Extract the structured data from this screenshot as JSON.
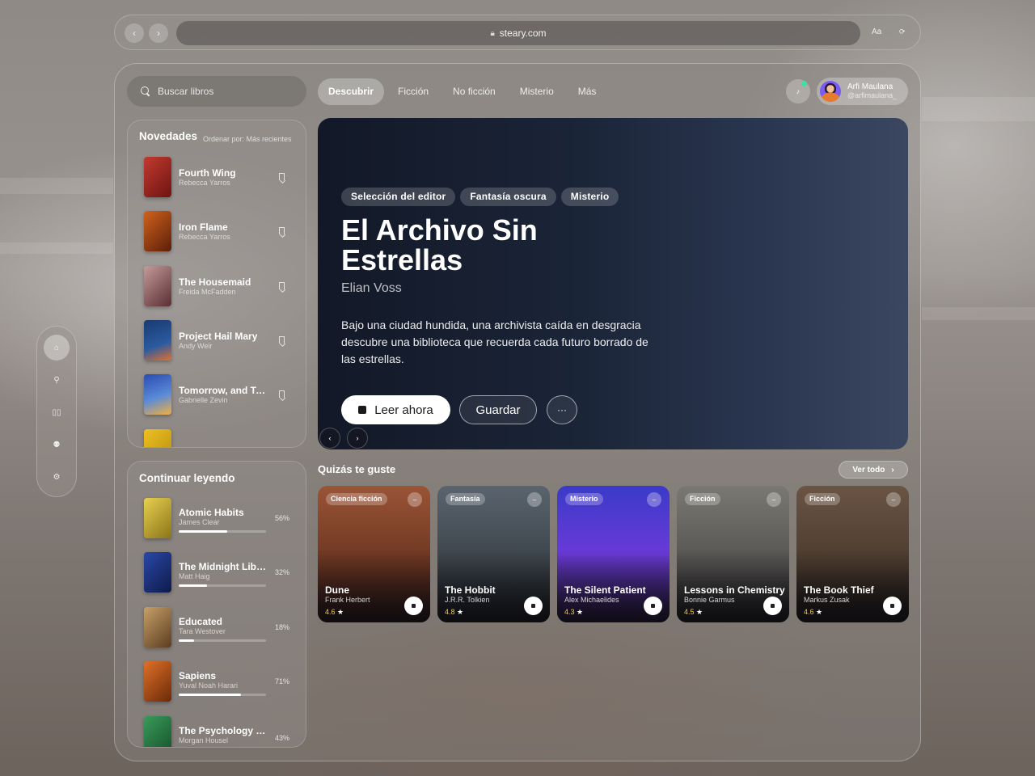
{
  "browser": {
    "url": "steary.com",
    "text_size": "Aa",
    "reload_icon": "reload-icon"
  },
  "search": {
    "placeholder": "Buscar libros"
  },
  "tabs": [
    {
      "label": "Descubrir",
      "active": true
    },
    {
      "label": "Ficción"
    },
    {
      "label": "No ficción"
    },
    {
      "label": "Misterio"
    },
    {
      "label": "Más"
    }
  ],
  "user": {
    "name": "Arfi Maulana",
    "handle": "@arfimaulana_"
  },
  "novedades": {
    "title": "Novedades",
    "sort": "Ordenar por: Más recientes",
    "items": [
      {
        "title": "Fourth Wing",
        "author": "Rebecca Yarros",
        "color": "#a3201d"
      },
      {
        "title": "Iron Flame",
        "author": "Rebecca Yarros",
        "color": "#b24a12"
      },
      {
        "title": "The Housemaid",
        "author": "Freida McFadden",
        "color": "#9a6a6c"
      },
      {
        "title": "Project Hail Mary",
        "author": "Andy Weir",
        "color": "#1e4e88"
      },
      {
        "title": "Tomorrow, and Tomorrow, and Tomorrow",
        "author": "Gabrielle Zevin",
        "color": "#3c62b8"
      }
    ]
  },
  "continuar": {
    "title": "Continuar leyendo",
    "items": [
      {
        "title": "Atomic Habits",
        "author": "James Clear",
        "progress": 56,
        "pct": "56%",
        "color": "#c9b233"
      },
      {
        "title": "The Midnight Library",
        "author": "Matt Haig",
        "progress": 32,
        "pct": "32%",
        "color": "#1f3c8a"
      },
      {
        "title": "Educated",
        "author": "Tara Westover",
        "progress": 18,
        "pct": "18%",
        "color": "#a07848"
      },
      {
        "title": "Sapiens",
        "author": "Yuval Noah Harari",
        "progress": 71,
        "pct": "71%",
        "color": "#c05a20"
      },
      {
        "title": "The Psychology of Money",
        "author": "Morgan Housel",
        "progress": 43,
        "pct": "43%",
        "color": "#2e7a4a"
      }
    ]
  },
  "hero": {
    "chips": [
      "Selección del editor",
      "Fantasía oscura",
      "Misterio"
    ],
    "title": "El Archivo Sin Estrellas",
    "author": "Elian Voss",
    "description": "Bajo una ciudad hundida, una archivista caída en desgracia descubre una biblioteca que recuerda cada futuro borrado de las estrellas.",
    "read_label": "Leer ahora",
    "save_label": "Guardar",
    "more_label": "···"
  },
  "recommendations": {
    "title": "Quizás te guste",
    "see_all": "Ver todo",
    "cards": [
      {
        "genre": "Ciencia ficción",
        "title": "Dune",
        "author": "Frank Herbert",
        "rating": "4.6",
        "color": "#8a4a2e"
      },
      {
        "genre": "Fantasía",
        "title": "The Hobbit",
        "author": "J.R.R. Tolkien",
        "rating": "4.8",
        "color": "#4c545c"
      },
      {
        "genre": "Misterio",
        "title": "The Silent Patient",
        "author": "Alex Michaelides",
        "rating": "4.3",
        "color": "#5a3ed0"
      },
      {
        "genre": "Ficción",
        "title": "Lessons in Chemistry",
        "author": "Bonnie Garmus",
        "rating": "4.5",
        "color": "#6a6864"
      },
      {
        "genre": "Ficción",
        "title": "The Book Thief",
        "author": "Markus Zusak",
        "rating": "4.6",
        "color": "#5c4838"
      }
    ]
  }
}
